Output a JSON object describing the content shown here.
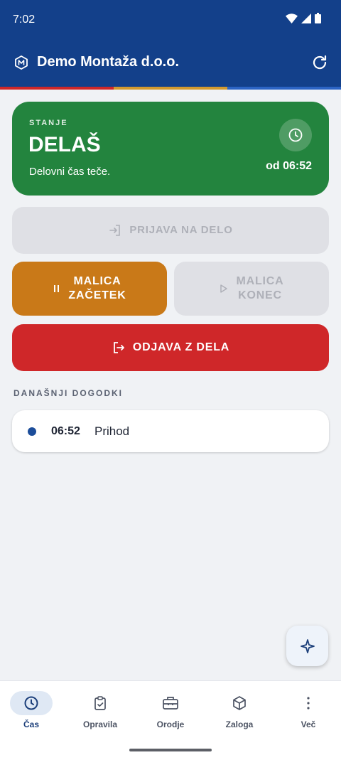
{
  "colors": {
    "brand": "#13408a",
    "status_green": "#23843e",
    "break_orange": "#c97918",
    "logout_red": "#cf2729",
    "stripe_red": "#cf2729",
    "stripe_amber": "#d39a2f",
    "stripe_blue": "#2c64c4",
    "event_dot": "#1c4d9a"
  },
  "status_bar": {
    "time": "7:02"
  },
  "app_bar": {
    "title": "Demo Montaža d.o.o.",
    "logo_icon": "hexagon-m-icon",
    "refresh_icon": "refresh-icon"
  },
  "status_card": {
    "label": "STANJE",
    "state": "DELAŠ",
    "description": "Delovni čas teče.",
    "since": "od 06:52",
    "icon": "clock-icon"
  },
  "actions": {
    "login_label": "PRIJAVA NA DELO",
    "break_start_line1": "MALICA",
    "break_start_line2": "ZAČETEK",
    "break_end_line1": "MALICA",
    "break_end_line2": "KONEC",
    "logout_label": "ODJAVA Z DELA"
  },
  "events": {
    "title": "DANAŠNJI DOGODKI",
    "items": [
      {
        "time": "06:52",
        "type": "Prihod"
      }
    ]
  },
  "fab": {
    "icon": "sparkle-icon"
  },
  "bottom_nav": {
    "items": [
      {
        "label": "Čas",
        "icon": "clock-icon",
        "active": true
      },
      {
        "label": "Opravila",
        "icon": "clipboard-check-icon",
        "active": false
      },
      {
        "label": "Orodje",
        "icon": "toolbox-icon",
        "active": false
      },
      {
        "label": "Zaloga",
        "icon": "box-icon",
        "active": false
      },
      {
        "label": "Več",
        "icon": "more-vertical-icon",
        "active": false
      }
    ]
  }
}
